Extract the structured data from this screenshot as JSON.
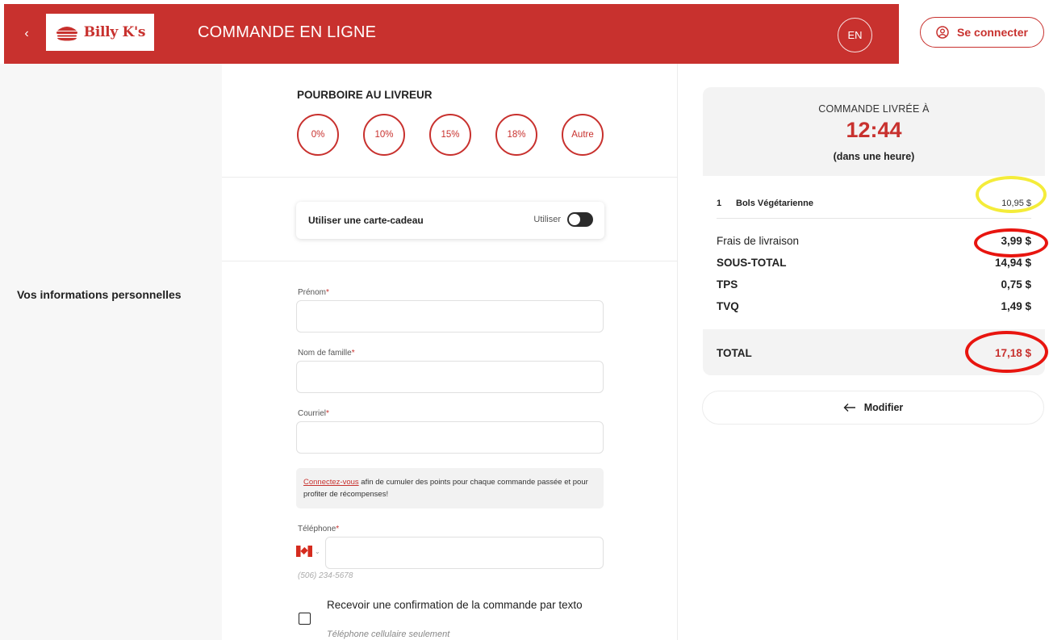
{
  "header": {
    "back_icon": "chevron-left-icon",
    "logo_text": "Billy K's",
    "title": "COMMANDE EN LIGNE",
    "lang": "EN",
    "login_label": "Se connecter",
    "login_icon": "user-circle-icon",
    "brand_color": "#c8312e"
  },
  "sidebar": {
    "section_label": "Vos informations personnelles"
  },
  "tips": {
    "heading": "POURBOIRE AU LIVREUR",
    "options": [
      "0%",
      "10%",
      "15%",
      "18%",
      "Autre"
    ]
  },
  "gift_card": {
    "label": "Utiliser une carte-cadeau",
    "toggle_label": "Utiliser",
    "enabled": false
  },
  "form": {
    "first_name_label": "Prénom",
    "last_name_label": "Nom de famille",
    "email_label": "Courriel",
    "required_mark": "*",
    "first_name_value": "",
    "last_name_value": "",
    "email_value": "",
    "loyalty_link": "Connectez-vous",
    "loyalty_text": " afin de cumuler des points pour chaque commande passée et pour profiter de récompenses!",
    "phone_label": "Téléphone",
    "phone_country": "CA",
    "phone_value": "",
    "phone_hint": "(506) 234-5678",
    "sms_label": "Recevoir une confirmation de la commande par texto",
    "sms_hint": "Téléphone cellulaire seulement",
    "sms_checked": false
  },
  "summary": {
    "kicker": "COMMANDE LIVRÉE À",
    "time": "12:44",
    "time_note": "(dans une heure)",
    "items": [
      {
        "qty": "1",
        "name": "Bols Végétarienne",
        "price": "10,95 $"
      }
    ],
    "delivery_label": "Frais de livraison",
    "delivery_value": "3,99 $",
    "subtotal_label": "SOUS-TOTAL",
    "subtotal_value": "14,94 $",
    "tps_label": "TPS",
    "tps_value": "0,75 $",
    "tvq_label": "TVQ",
    "tvq_value": "1,49 $",
    "total_label": "TOTAL",
    "total_value": "17,18 $",
    "modify_label": "Modifier",
    "modify_icon": "arrow-left-icon"
  },
  "annotations": {
    "yellow_circle_color": "#f4ec3a",
    "red_circle_color": "#e8150f"
  }
}
